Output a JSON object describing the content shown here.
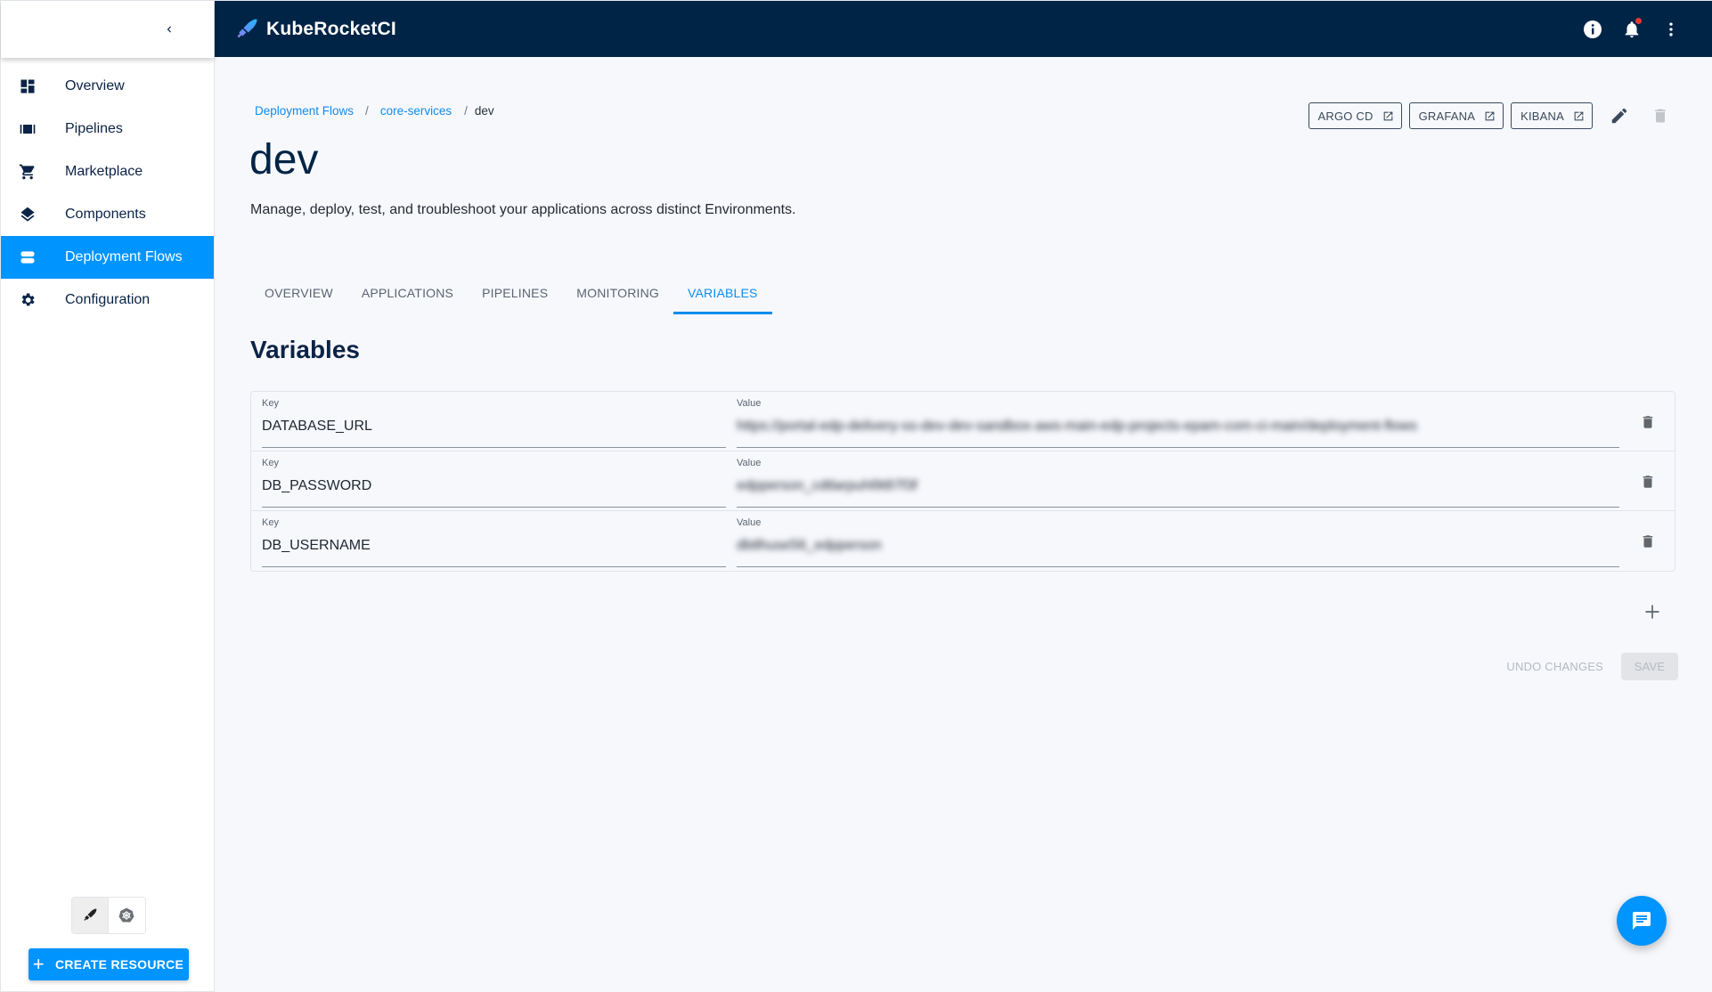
{
  "app": {
    "name": "KubeRocketCI",
    "notification_count_visible": true
  },
  "sidebar": {
    "items": [
      {
        "label": "Overview",
        "icon": "dashboard-icon",
        "active": false
      },
      {
        "label": "Pipelines",
        "icon": "pipelines-icon",
        "active": false
      },
      {
        "label": "Marketplace",
        "icon": "cart-icon",
        "active": false
      },
      {
        "label": "Components",
        "icon": "layers-icon",
        "active": false
      },
      {
        "label": "Deployment Flows",
        "icon": "deployment-flows-icon",
        "active": true
      },
      {
        "label": "Configuration",
        "icon": "gear-icon",
        "active": false
      }
    ],
    "mode_toggle": [
      "rocket-mode",
      "kubernetes-mode"
    ],
    "create_button": "CREATE RESOURCE"
  },
  "breadcrumb": {
    "items": [
      "Deployment Flows",
      "core-services"
    ],
    "current": "dev",
    "separator": "/"
  },
  "header": {
    "title": "dev",
    "description": "Manage, deploy, test, and troubleshoot your applications across distinct Environments.",
    "links": [
      "ARGO CD",
      "GRAFANA",
      "KIBANA"
    ]
  },
  "tabs": [
    {
      "label": "OVERVIEW",
      "active": false
    },
    {
      "label": "APPLICATIONS",
      "active": false
    },
    {
      "label": "PIPELINES",
      "active": false
    },
    {
      "label": "MONITORING",
      "active": false
    },
    {
      "label": "VARIABLES",
      "active": true
    }
  ],
  "variables": {
    "title": "Variables",
    "key_label": "Key",
    "value_label": "Value",
    "rows": [
      {
        "key": "DATABASE_URL",
        "value": "https://portal-edp-delivery-ss-dev-dev-sandbox-aws-main-edp-projects-epam-com-ci-main/deployment-flows"
      },
      {
        "key": "DB_PASSWORD",
        "value": "edpperson_cdtlarpuhl9t87f3f"
      },
      {
        "key": "DB_USERNAME",
        "value": "dbtlhuse56_edpperson"
      }
    ],
    "undo_label": "UNDO CHANGES",
    "save_label": "SAVE"
  },
  "colors": {
    "topbar": "#002446",
    "accent": "#0094ff",
    "link": "#0f8cf0",
    "notification_dot": "#e53935"
  }
}
